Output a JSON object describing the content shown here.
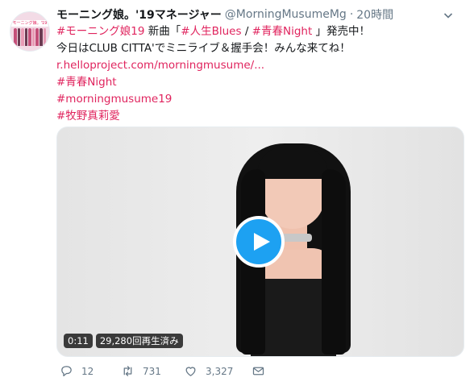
{
  "tweet": {
    "author_name": "モーニング娘。'19マネージャー",
    "author_handle": "@MorningMusumeMg",
    "separator": "·",
    "time": "20時間",
    "avatar_text": "モーニング娘。'19",
    "line1": {
      "tag1": "#モーニング娘19",
      "t1": " 新曲「",
      "tag2": "#人生Blues",
      "t2": " / ",
      "tag3": "#青春Night",
      "t3": " 」発売中！"
    },
    "line2": "今日はCLUB CITTA'でミニライブ＆握手会！みんな来てね！",
    "link": "r.helloproject.com/morningmusume/...",
    "hashtags": [
      "#青春Night",
      "#morningmusume19",
      "#牧野真莉愛"
    ]
  },
  "video": {
    "duration": "0:11",
    "views": "29,280回再生済み"
  },
  "actions": {
    "replies": "12",
    "retweets": "731",
    "likes": "3,327"
  },
  "colors": {
    "accent": "#e0245e",
    "play": "#1da1f2",
    "muted": "#657786"
  }
}
